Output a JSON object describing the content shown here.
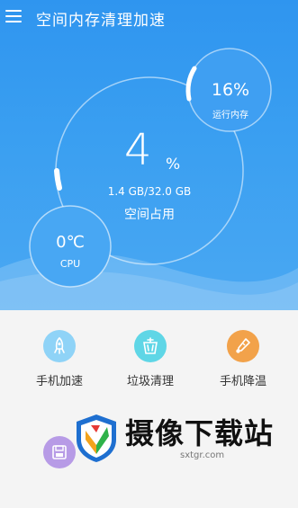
{
  "header": {
    "title": "空间内存清理加速",
    "menu_icon": "hamburger-menu-icon"
  },
  "storage": {
    "percent": "4",
    "unit": "%",
    "detail": "1.4 GB/32.0 GB",
    "label": "空间占用"
  },
  "ram": {
    "percent": "16%",
    "label": "运行内存"
  },
  "cpu": {
    "temperature": "0℃",
    "label": "CPU"
  },
  "tools": [
    {
      "label": "手机加速",
      "icon": "rocket-icon",
      "color": "#8fd3f7"
    },
    {
      "label": "垃圾清理",
      "icon": "trash-icon",
      "color": "#5fd6e6"
    },
    {
      "label": "手机降温",
      "icon": "thermometer-icon",
      "color": "#f2a24a"
    },
    {
      "label": "",
      "icon": "save-icon",
      "color": "#b79be6"
    }
  ],
  "watermark": {
    "text": "摄像下载站",
    "url": "sxtgr.com"
  },
  "colors": {
    "hero_top": "#2f95ef",
    "hero_bottom": "#4aa8f2",
    "ring": "#ffffff",
    "panel_bg": "#f4f4f4"
  }
}
